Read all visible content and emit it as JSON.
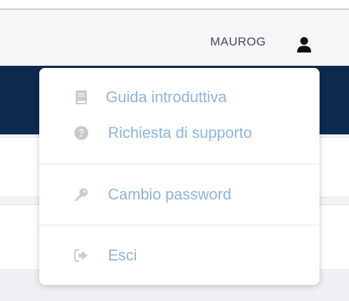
{
  "header": {
    "username": "MAUROG"
  },
  "menu": {
    "items": [
      {
        "label": "Guida introduttiva",
        "icon": "book-icon"
      },
      {
        "label": "Richiesta di supporto",
        "icon": "question-circle-icon"
      },
      {
        "label": "Cambio password",
        "icon": "key-icon"
      },
      {
        "label": "Esci",
        "icon": "sign-out-icon"
      }
    ]
  },
  "colors": {
    "accent_text": "#8fb3dc",
    "icon_gray": "#c8ccd2",
    "navy": "#0d2a4e"
  }
}
